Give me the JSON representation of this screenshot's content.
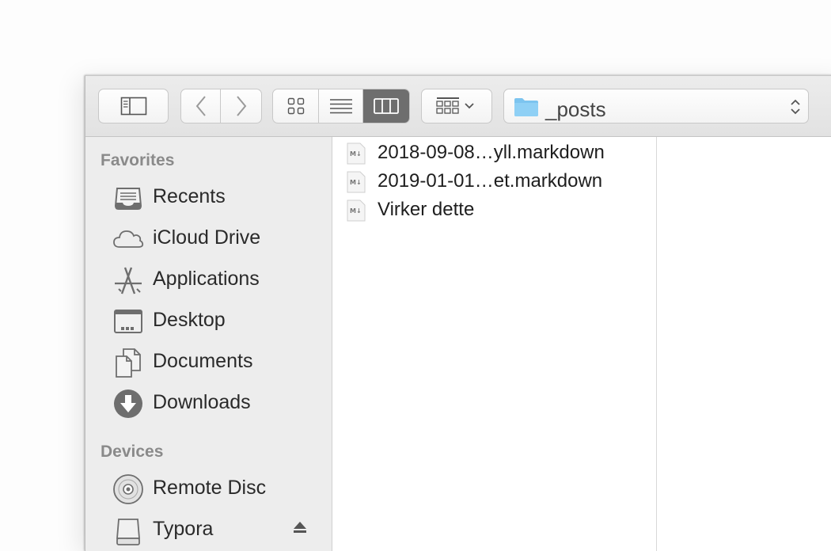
{
  "toolbar": {
    "path_folder": "_posts",
    "view_mode": "columns"
  },
  "sidebar": {
    "favorites_title": "Favorites",
    "favorites": [
      {
        "label": "Recents",
        "icon": "recents-icon"
      },
      {
        "label": "iCloud Drive",
        "icon": "cloud-icon"
      },
      {
        "label": "Applications",
        "icon": "applications-icon"
      },
      {
        "label": "Desktop",
        "icon": "desktop-icon"
      },
      {
        "label": "Documents",
        "icon": "documents-icon"
      },
      {
        "label": "Downloads",
        "icon": "downloads-icon"
      }
    ],
    "devices_title": "Devices",
    "devices": [
      {
        "label": "Remote Disc",
        "icon": "disc-icon"
      },
      {
        "label": "Typora",
        "icon": "drive-icon"
      }
    ]
  },
  "files": [
    {
      "name": "2018-09-08…yll.markdown",
      "icon": "markdown-file-icon"
    },
    {
      "name": "2019-01-01…et.markdown",
      "icon": "markdown-file-icon"
    },
    {
      "name": "Virker dette",
      "icon": "markdown-file-icon"
    }
  ],
  "colors": {
    "folder": "#7cc4ef",
    "icon_gray": "#6e6e6e",
    "active_segment": "#6e6e6e"
  }
}
